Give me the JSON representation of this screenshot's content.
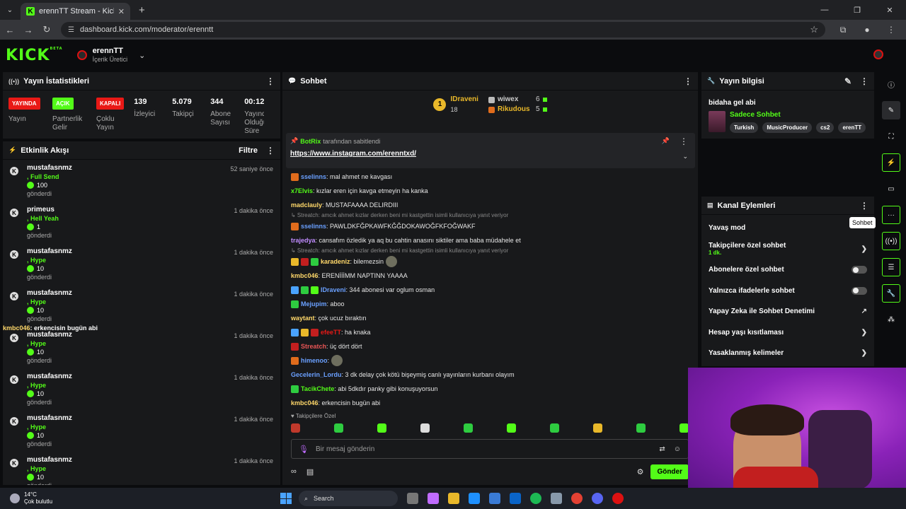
{
  "browser": {
    "tab_title": "erennTT Stream - Kick Dashboard",
    "tab_favicon": "K",
    "url": "dashboard.kick.com/moderator/erenntt"
  },
  "header": {
    "logo": "KICK",
    "logo_sup": "BETA",
    "channel_name": "erennTT",
    "channel_role": "İçerik Üretici"
  },
  "stats_panel": {
    "title": "Yayın İstatistikleri",
    "items": [
      {
        "badge": "YAYINDA",
        "label": "Yayın",
        "color": "#e91916"
      },
      {
        "badge": "AÇIK",
        "label": "Partnerlik Gelir Programı",
        "color": "#53fc18"
      },
      {
        "badge": "KAPALI",
        "label": "Çoklu Yayın",
        "color": "#e91916"
      }
    ],
    "numbers": [
      {
        "value": "139",
        "label": "İzleyici"
      },
      {
        "value": "5.079",
        "label": "Takipçi"
      },
      {
        "value": "344",
        "label": "Abone Sayısı"
      },
      {
        "value": "00:12",
        "label": "Yayında Olduğu Süre"
      }
    ]
  },
  "activity": {
    "title": "Etkinlik Akışı",
    "filter": "Filtre",
    "items": [
      {
        "user": "mustafasnmz",
        "type": ", Full Send",
        "amount": "100",
        "sent": "gönderdi",
        "time": "52 saniye önce"
      },
      {
        "user": "primeus",
        "type": ", Hell Yeah",
        "amount": "1",
        "sent": "gönderdi",
        "time": "1 dakika önce"
      },
      {
        "user": "mustafasnmz",
        "type": ", Hype",
        "amount": "10",
        "sent": "gönderdi",
        "time": "1 dakika önce"
      },
      {
        "user": "mustafasnmz",
        "type": ", Hype",
        "amount": "10",
        "sent": "gönderdi",
        "time": "1 dakika önce"
      },
      {
        "user": "mustafasnmz",
        "type": ", Hype",
        "amount": "10",
        "sent": "gönderdi",
        "time": "1 dakika önce"
      },
      {
        "user": "mustafasnmz",
        "type": ", Hype",
        "amount": "10",
        "sent": "gönderdi",
        "time": "1 dakika önce"
      },
      {
        "user": "mustafasnmz",
        "type": ", Hype",
        "amount": "10",
        "sent": "gönderdi",
        "time": "1 dakika önce"
      },
      {
        "user": "mustafasnmz",
        "type": ", Hype",
        "amount": "10",
        "sent": "gönderdi",
        "time": "1 dakika önce"
      }
    ],
    "overlay_user": "kmbc046",
    "overlay_text": ": erkencisin bugün abi"
  },
  "chat": {
    "title": "Sohbet",
    "leader1_name": "IDraveni",
    "leader1_value": "18",
    "leader2_name": "wiwex",
    "leader2_value": "6",
    "leader3_name": "Rikudous",
    "leader3_value": "5",
    "pinned_by": "BotRix",
    "pinned_suffix": "tarafından sabitlendi",
    "pinned_link": "https://www.instagram.com/erenntxd/",
    "messages": [
      {
        "user": "sselinns",
        "color": "#6aa0ff",
        "text": ": mal ahmet ne kavgası",
        "badges": [
          "#e06c1c"
        ]
      },
      {
        "user": "x7Elvis",
        "color": "#53fc18",
        "text": ": kızlar eren için kavga etmeyin ha kanka",
        "badges": []
      },
      {
        "user": "madclauly",
        "color": "#ffd86a",
        "text": ": MUSTAFAAAA DELIRDIII",
        "badges": []
      },
      {
        "reply": "↳ Streatch: amcık ahmet kızlar derken beni mi kastgettin isimli kullanıcıya yanıt veriyor"
      },
      {
        "user": "sselinns",
        "color": "#6aa0ff",
        "text": ": PAWLDKFĞPKAWFKĞĞDOKAWOĞFKFOĞWAKF",
        "badges": [
          "#e06c1c"
        ]
      },
      {
        "user": "trajedya",
        "color": "#c08cff",
        "text": ": cansafım özledik ya aq bu cahtin anasını siktiler ama baba müdahele et",
        "badges": []
      },
      {
        "reply": "↳ Streatch: amcık ahmet kızlar derken beni mi kastgettin isimli kullanıcıya yanıt veriyor"
      },
      {
        "user": "karadeniz",
        "color": "#ffd86a",
        "text": ": bilemezsin",
        "badges": [
          "#e9b82a",
          "#c21f1f",
          "#2ecc40"
        ],
        "emote": true
      },
      {
        "user": "kmbc046",
        "color": "#ffd86a",
        "text": ": ERENİİİMM NAPTINN YAAAA",
        "badges": []
      },
      {
        "user": "IDraveni",
        "color": "#6aa0ff",
        "text": ": 344 abonesi var oglum osman",
        "badges": [
          "#4aa3ff",
          "#2ecc40",
          "#53fc18"
        ]
      },
      {
        "user": "Mejupim",
        "color": "#6aa0ff",
        "text": ": aboo",
        "badges": [
          "#2ecc40"
        ]
      },
      {
        "user": "waytant",
        "color": "#ffd86a",
        "text": ": çok ucuz bıraktın",
        "badges": []
      },
      {
        "user": "efeeTT",
        "color": "#e91916",
        "text": ": ha knaka",
        "badges": [
          "#4aa3ff",
          "#e9b82a",
          "#c21f1f"
        ]
      },
      {
        "user": "Streatch",
        "color": "#e95555",
        "text": ": üç dört dört",
        "badges": [
          "#c21f1f"
        ]
      },
      {
        "user": "himenoo",
        "color": "#6aa0ff",
        "text": ":",
        "badges": [
          "#e06c1c"
        ],
        "emote": true
      },
      {
        "user": "Gecelerin_Lordu",
        "color": "#6aa0ff",
        "text": ": 3 dk delay çok kötü bişeymiş canlı yayınların kurbanı olayım",
        "badges": []
      },
      {
        "user": "TacikChete",
        "color": "#53fc18",
        "text": ": abi 5dkdır panky gibi konuşuyorsun",
        "badges": [
          "#2ecc40"
        ]
      },
      {
        "user": "kmbc046",
        "color": "#ffd86a",
        "text": ": erkencisin bugün abi",
        "badges": []
      }
    ],
    "followers_only_label": "♥ Takipçilere Özel",
    "input_placeholder": "Bir mesaj gönderin",
    "send_label": "Gönder"
  },
  "stream_info": {
    "title": "Yayın bilgisi",
    "stream_title": "bidaha gel abi",
    "category": "Sadece Sohbet",
    "tags": [
      "Turkish",
      "MusicProducer",
      "cs2",
      "erenTT"
    ]
  },
  "channel_actions": {
    "title": "Kanal Eylemleri",
    "rows": [
      {
        "label": "Yavaş mod",
        "kind": "none"
      },
      {
        "label": "Takipçilere özel sohbet",
        "sub": "1 dk.",
        "kind": "chevron"
      },
      {
        "label": "Abonelere özel sohbet",
        "kind": "toggle"
      },
      {
        "label": "Yalnızca ifadelerle sohbet",
        "kind": "toggle"
      },
      {
        "label": "Yapay Zeka ile Sohbet Denetimi",
        "kind": "external"
      },
      {
        "label": "Hesap yaşı kısıtlaması",
        "kind": "chevron"
      },
      {
        "label": "Yasaklanmış kelimeler",
        "kind": "chevron"
      }
    ]
  },
  "rail_tooltip": "Sohbet",
  "taskbar": {
    "temp": "14°C",
    "weather": "Çok bulutlu",
    "search": "Search"
  }
}
